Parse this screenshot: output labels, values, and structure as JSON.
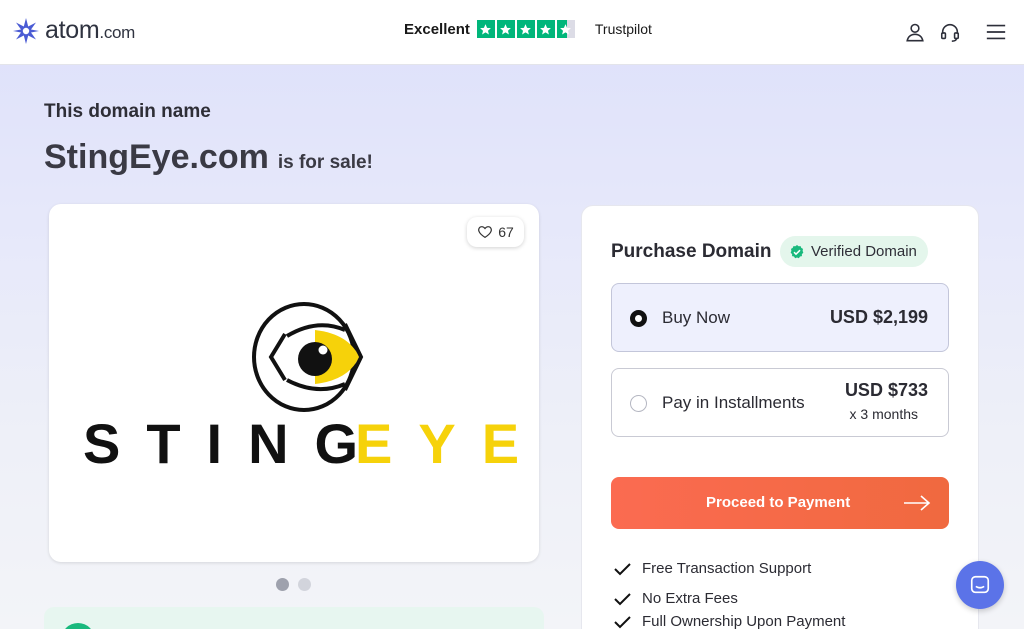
{
  "header": {
    "logo_text": "atom",
    "logo_tld": ".com",
    "trust_label": "Excellent",
    "trust_brand": "Trustpilot",
    "trust_rating": 4.5,
    "icons": [
      "star-logo-icon",
      "user-icon",
      "headset-icon",
      "menu-icon"
    ]
  },
  "hero": {
    "eyebrow": "This domain name",
    "domain": "StingEye.com",
    "suffix": "is for sale!"
  },
  "logo_card": {
    "likes": "67",
    "logo_word_black": "STING",
    "logo_word_yellow": "EYE",
    "slide_count": 2,
    "active_slide": 1
  },
  "purchase": {
    "title": "Purchase Domain",
    "badge": "Verified Domain",
    "options": [
      {
        "label": "Buy Now",
        "price": "USD $2,199",
        "sub": "",
        "selected": true
      },
      {
        "label": "Pay in Installments",
        "price": "USD $733",
        "sub": "x 3 months",
        "selected": false
      }
    ],
    "cta": "Proceed to Payment",
    "features": [
      "Free Transaction Support",
      "No Extra Fees",
      "Full Ownership Upon Payment"
    ]
  },
  "colors": {
    "accent": "#f0693f",
    "brand": "#4a5bd4",
    "trust_green": "#00b67a",
    "logo_yellow": "#f6d20a"
  }
}
